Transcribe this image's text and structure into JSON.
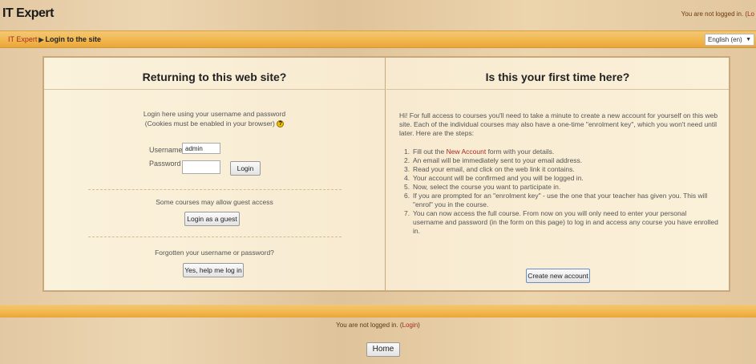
{
  "header": {
    "site_title": "IT Expert",
    "login_text": "You are not logged in. (",
    "login_link": "Lo"
  },
  "navbar": {
    "home_link": "IT Expert",
    "separator": "▶",
    "current": "Login to the site",
    "language": "English (en)"
  },
  "login_panel": {
    "title": "Returning to this web site?",
    "intro_line1": "Login here using your username and password",
    "intro_line2": "(Cookies must be enabled in your browser)",
    "username_label": "Username",
    "username_value": "admin",
    "password_label": "Password",
    "password_value": "",
    "login_button": "Login",
    "guest_text": "Some courses may allow guest access",
    "guest_button": "Login as a guest",
    "forgot_text": "Forgotten your username or password?",
    "forgot_button": "Yes, help me log in"
  },
  "signup_panel": {
    "title": "Is this your first time here?",
    "intro": "Hi! For full access to courses you'll need to take a minute to create a new account for yourself on this web site. Each of the individual courses may also have a one-time \"enrolment key\", which you won't need until later. Here are the steps:",
    "step1_pre": "Fill out the ",
    "step1_link": "New Account",
    "step1_post": " form with your details.",
    "steps": [
      "An email will be immediately sent to your email address.",
      "Read your email, and click on the web link it contains.",
      "Your account will be confirmed and you will be logged in.",
      "Now, select the course you want to participate in.",
      "If you are prompted for an \"enrolment key\" - use the one that your teacher has given you. This will \"enrol\" you in the course.",
      "You can now access the full course. From now on you will only need to enter your personal username and password (in the form on this page) to log in and access any course you have enrolled in."
    ],
    "create_button": "Create new account"
  },
  "footer": {
    "login_text": "You are not logged in. (",
    "login_link": "Login",
    "login_close": ")",
    "home_button": "Home"
  }
}
